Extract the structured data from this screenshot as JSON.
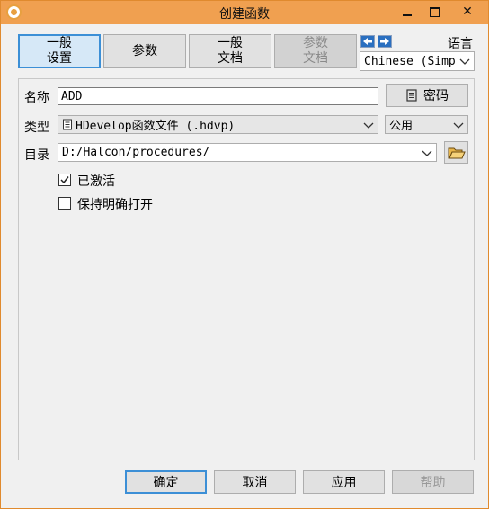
{
  "window": {
    "title": "创建函数",
    "close_glyph": "✕"
  },
  "tabs": [
    {
      "label": "一般\n设置",
      "state": "active"
    },
    {
      "label": "参数",
      "state": "normal"
    },
    {
      "label": "一般\n文档",
      "state": "normal"
    },
    {
      "label": "参数\n文档",
      "state": "disabled"
    }
  ],
  "language": {
    "label": "语言",
    "selected": "Chinese (Simp"
  },
  "form": {
    "name_label": "名称",
    "name_value": "ADD",
    "password_button": "密码",
    "type_label": "类型",
    "type_value": "HDevelop函数文件 (.hdvp)",
    "visibility_value": "公用",
    "dir_label": "目录",
    "dir_value": "D:/Halcon/procedures/",
    "activated_label": "已激活",
    "activated_checked": true,
    "keep_open_label": "保持明确打开",
    "keep_open_checked": false
  },
  "footer": {
    "ok": "确定",
    "cancel": "取消",
    "apply": "应用",
    "help": "帮助"
  },
  "colors": {
    "titlebar": "#f0a050",
    "accent": "#3c8fd6"
  }
}
